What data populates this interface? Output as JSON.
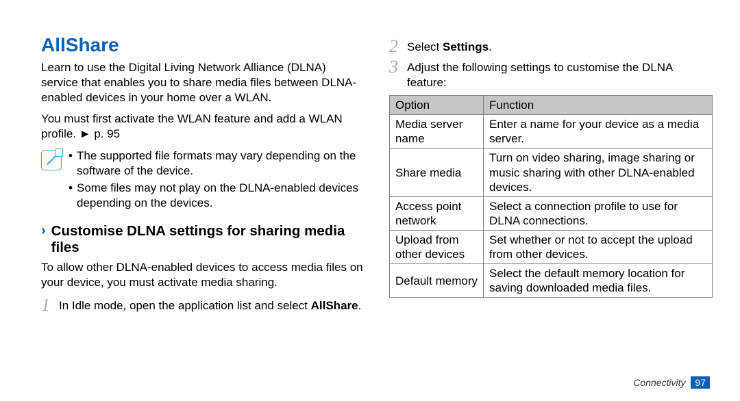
{
  "heading": "AllShare",
  "intro_p1": "Learn to use the Digital Living Network Alliance (DLNA) service that enables you to share media files between DLNA-enabled devices in your home over a WLAN.",
  "intro_p2_prefix": "You must first activate the WLAN feature and add a WLAN profile. ",
  "crossref_arrow": "►",
  "crossref_text": "p. 95",
  "notes": [
    "The supported file formats may vary depending on the software of the device.",
    "Some files may not play on the DLNA-enabled devices depending on the devices."
  ],
  "sub_chevron": "›",
  "sub_heading": "Customise DLNA settings for sharing media files",
  "sub_intro": "To allow other DLNA-enabled devices to access media files on your device, you must activate media sharing.",
  "step1_num": "1",
  "step1_prefix": "In Idle mode, open the application list and select ",
  "step1_bold": "AllShare",
  "step1_suffix": ".",
  "step2_num": "2",
  "step2_prefix": "Select ",
  "step2_bold": "Settings",
  "step2_suffix": ".",
  "step3_num": "3",
  "step3_text": "Adjust the following settings to customise the DLNA feature:",
  "table": {
    "headers": [
      "Option",
      "Function"
    ],
    "rows": [
      [
        "Media server name",
        "Enter a name for your device as a media server."
      ],
      [
        "Share media",
        "Turn on video sharing, image sharing or music sharing with other DLNA-enabled devices."
      ],
      [
        "Access point network",
        "Select a connection profile to use for DLNA connections."
      ],
      [
        "Upload from other devices",
        "Set whether or not to accept the upload from other devices."
      ],
      [
        "Default memory",
        "Select the default memory location for saving downloaded media files."
      ]
    ]
  },
  "footer_section": "Connectivity",
  "footer_page": "97"
}
